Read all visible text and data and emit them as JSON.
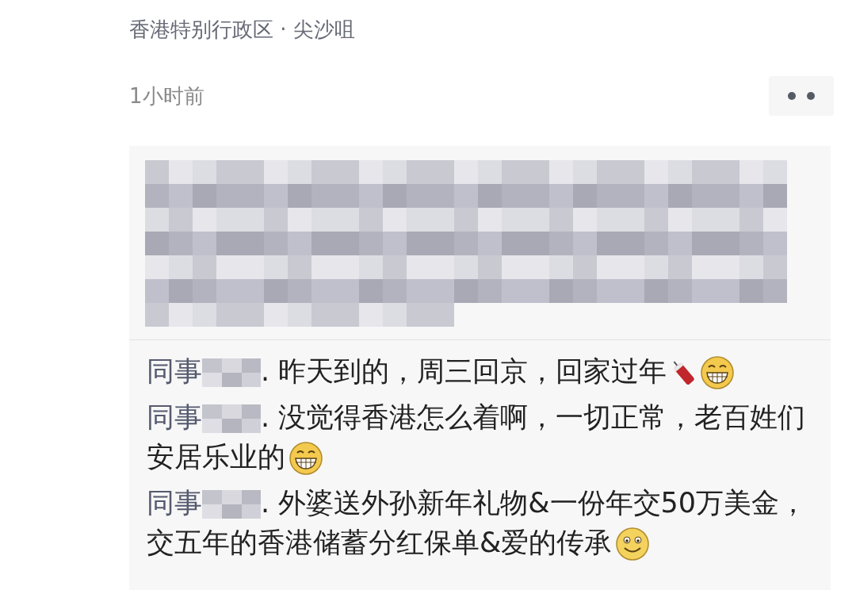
{
  "location": "香港特别行政区 · 尖沙咀",
  "time": "1小时前",
  "comments": [
    {
      "prefix": "同事",
      "text": ". 昨天到的，周三回京，回家过年",
      "icons": [
        {
          "kind": "firecracker"
        },
        {
          "kind": "grin"
        }
      ]
    },
    {
      "prefix": "同事",
      "text": ". 没觉得香港怎么着啊，一切正常，老百姓们安居乐业的",
      "icons": [
        {
          "kind": "grin"
        }
      ]
    },
    {
      "prefix": "同事",
      "text": ". 外婆送外孙新年礼物&一份年交50万美金，交五年的香港储蓄分红保单&爱的传承",
      "icons": [
        {
          "kind": "smile"
        }
      ]
    }
  ]
}
